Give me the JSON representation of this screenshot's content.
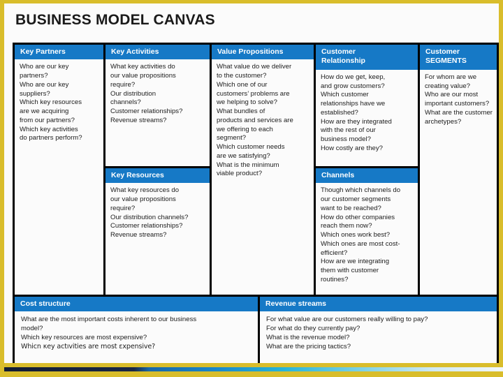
{
  "slide": {
    "title": "BUSINESS MODEL CANVAS",
    "accent_blue": "#1679C6",
    "border_gold": "#D9BD2B",
    "background": "#FBFBFB"
  },
  "blocks": {
    "key_partners": {
      "heading": "Key Partners",
      "lines": [
        "Who are our key",
        "partners?",
        "Who are our key",
        "suppliers?",
        "Which key resources",
        "are we acquiring",
        "from our partners?",
        "Which key activities",
        "do partners perform?"
      ]
    },
    "key_activities": {
      "heading": "Key Activities",
      "lines": [
        "What key activities do",
        "our value propositions",
        "require?",
        "Our distribution",
        "channels?",
        "Customer relationships?",
        "Revenue streams?"
      ]
    },
    "key_resources": {
      "heading": "Key Resources",
      "lines": [
        "What key resources do",
        "our value propositions",
        "require?",
        "Our distribution channels?",
        "Customer relationships?",
        "Revenue streams?"
      ]
    },
    "value_propositions": {
      "heading": "Value Propositions",
      "lines": [
        "What value do we deliver",
        "to the customer?",
        "Which one of our",
        "customers’ problems are",
        "we helping to solve?",
        "What bundles of",
        "products and services are",
        "we offering to each",
        "segment?",
        "Which customer needs",
        "are we satisfying?",
        "What is the minimum",
        "viable product?"
      ]
    },
    "customer_relationship": {
      "heading_line1": "Customer",
      "heading_line2": "Relationship",
      "lines": [
        "How do we get, keep,",
        "and grow customers?",
        "Which customer",
        "relationships have we",
        "established?",
        "How are they integrated",
        "with the rest of our",
        "business model?",
        "How costly are they?"
      ]
    },
    "channels": {
      "heading": "Channels",
      "lines": [
        "Though which channels do",
        "our customer segments",
        "want to be reached?",
        "How do other companies",
        "reach them now?",
        "Which ones work best?",
        "Which ones are most cost-",
        "efficient?",
        "How are we integrating",
        "them with customer",
        "routines?"
      ]
    },
    "customer_segments": {
      "heading_line1": "Customer",
      "heading_line2": "SEGMENTS",
      "lines": [
        "For whom are we",
        "creating value?",
        "Who are our most",
        "important customers?",
        "What are the customer",
        "archetypes?"
      ]
    },
    "cost_structure": {
      "heading": "Cost structure",
      "lines": [
        "What are the most important costs inherent to our business",
        "model?",
        "Which key resources are most expensive?"
      ],
      "garbled_line": "Whicn κey actıvities are most εxpensive?"
    },
    "revenue_streams": {
      "heading": "Revenue streams",
      "lines": [
        "For what value are our customers really willing to pay?",
        "For what do they currently pay?",
        "What is the revenue model?",
        "What are the pricing tactics?"
      ]
    }
  }
}
